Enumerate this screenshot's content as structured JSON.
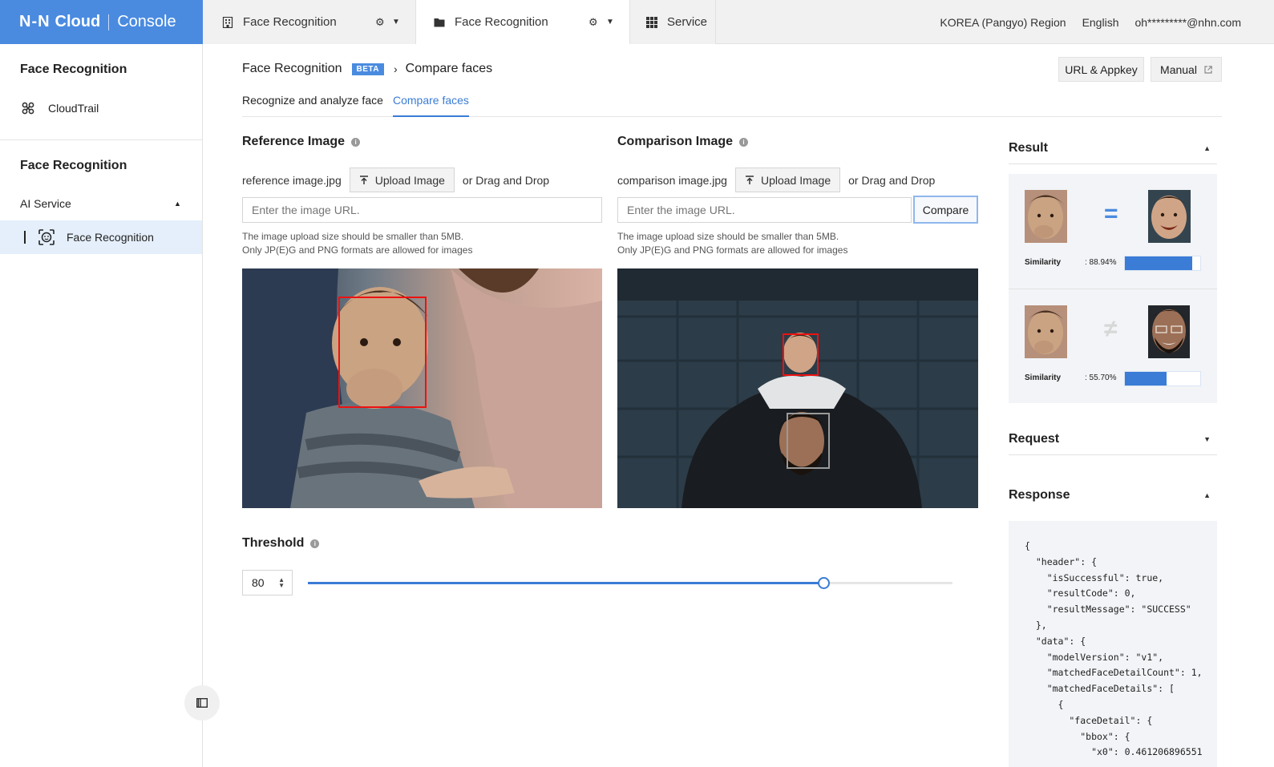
{
  "topbar": {
    "brand_mark": "N-N",
    "brand_cloud": "Cloud",
    "brand_console": "Console",
    "tabs": [
      {
        "label": "Face Recognition",
        "icon": "building-icon"
      },
      {
        "label": "Face Recognition",
        "icon": "folder-icon"
      },
      {
        "label": "Service",
        "icon": "grid-icon"
      }
    ],
    "region": "KOREA (Pangyo) Region",
    "language": "English",
    "account": "oh*********@nhn.com"
  },
  "sidebar": {
    "project_title": "Face Recognition",
    "project_items": [
      {
        "label": "CloudTrail",
        "icon": "cloudtrail-icon"
      }
    ],
    "service_title": "Face Recognition",
    "group": {
      "label": "AI Service",
      "expanded": true
    },
    "service_items": [
      {
        "label": "Face Recognition",
        "icon": "face-scan-icon",
        "active": true
      }
    ]
  },
  "main": {
    "breadcrumb": {
      "service": "Face Recognition",
      "badge": "BETA",
      "page": "Compare faces"
    },
    "buttons": {
      "url_appkey": "URL & Appkey",
      "manual": "Manual"
    },
    "subtabs": [
      {
        "label": "Recognize and analyze face",
        "active": false
      },
      {
        "label": "Compare faces",
        "active": true
      }
    ],
    "reference": {
      "title": "Reference Image",
      "filename": "reference image.jpg",
      "upload_label": "Upload Image",
      "drag_label": "or Drag and Drop",
      "url_placeholder": "Enter the image URL.",
      "hint_line1": "The image upload size should be smaller than 5MB.",
      "hint_line2": "Only JP(E)G and PNG formats are allowed for images"
    },
    "comparison": {
      "title": "Comparison Image",
      "filename": "comparison image.jpg",
      "upload_label": "Upload Image",
      "drag_label": "or Drag and Drop",
      "url_placeholder": "Enter the image URL.",
      "compare_label": "Compare",
      "hint_line1": "The image upload size should be smaller than 5MB.",
      "hint_line2": "Only JP(E)G and PNG formats are allowed for images"
    },
    "threshold": {
      "title": "Threshold",
      "value": "80",
      "slider_percent": 80
    }
  },
  "panel": {
    "result_title": "Result",
    "results": [
      {
        "symbol": "=",
        "match": true,
        "similarity_label": "Similarity",
        "similarity": ": 88.94%",
        "similarity_percent": 88.94,
        "symbol_color": "#4a8be0"
      },
      {
        "symbol": "≠",
        "match": false,
        "similarity_label": "Similarity",
        "similarity": ": 55.70%",
        "similarity_percent": 55.7,
        "symbol_color": "#d7d7d7"
      }
    ],
    "request_title": "Request",
    "response_title": "Response",
    "response_json": "{\n  \"header\": {\n    \"isSuccessful\": true,\n    \"resultCode\": 0,\n    \"resultMessage\": \"SUCCESS\"\n  },\n  \"data\": {\n    \"modelVersion\": \"v1\",\n    \"matchedFaceDetailCount\": 1,\n    \"matchedFaceDetails\": [\n      {\n        \"faceDetail\": {\n          \"bbox\": {\n            \"x0\": 0.461206896551"
  },
  "colors": {
    "brand": "#4a8be0",
    "accent": "#3a7cd6",
    "face_box": "#ee1111"
  }
}
